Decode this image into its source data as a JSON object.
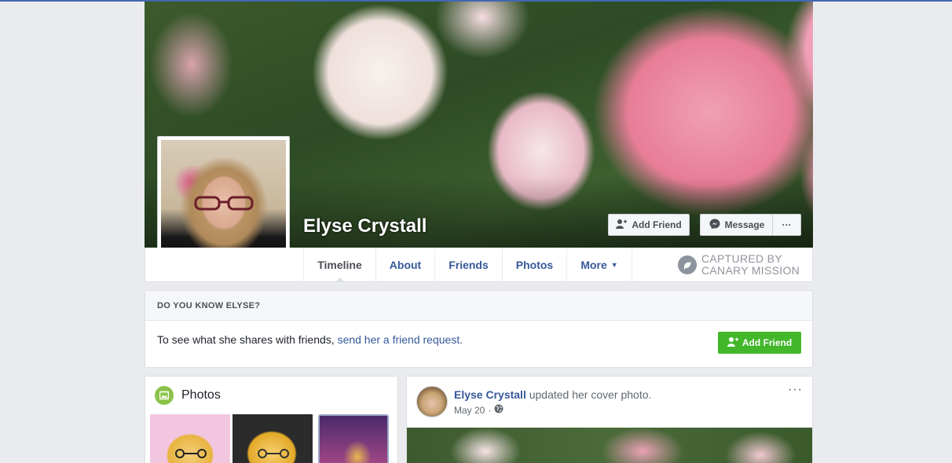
{
  "profile": {
    "name": "Elyse Crystall",
    "cover_buttons": {
      "add_friend": "Add Friend",
      "message": "Message",
      "more": "···"
    }
  },
  "nav": {
    "items": [
      {
        "label": "Timeline",
        "active": true
      },
      {
        "label": "About",
        "active": false
      },
      {
        "label": "Friends",
        "active": false
      },
      {
        "label": "Photos",
        "active": false
      },
      {
        "label": "More",
        "active": false
      }
    ],
    "more_arrow": "▼"
  },
  "watermark": {
    "line1": "CAPTURED BY",
    "line2": "CANARY MISSION"
  },
  "know_card": {
    "heading": "DO YOU KNOW ELYSE?",
    "text": "To see what she shares with friends, ",
    "link": "send her a friend request.",
    "button": "Add Friend"
  },
  "photos_card": {
    "title": "Photos"
  },
  "post": {
    "author": "Elyse Crystall",
    "action": " updated her cover photo.",
    "date": "May 20",
    "separator": "·",
    "options": "···"
  },
  "colors": {
    "link": "#365899",
    "green": "#42b72a",
    "background": "#e9ebee"
  }
}
